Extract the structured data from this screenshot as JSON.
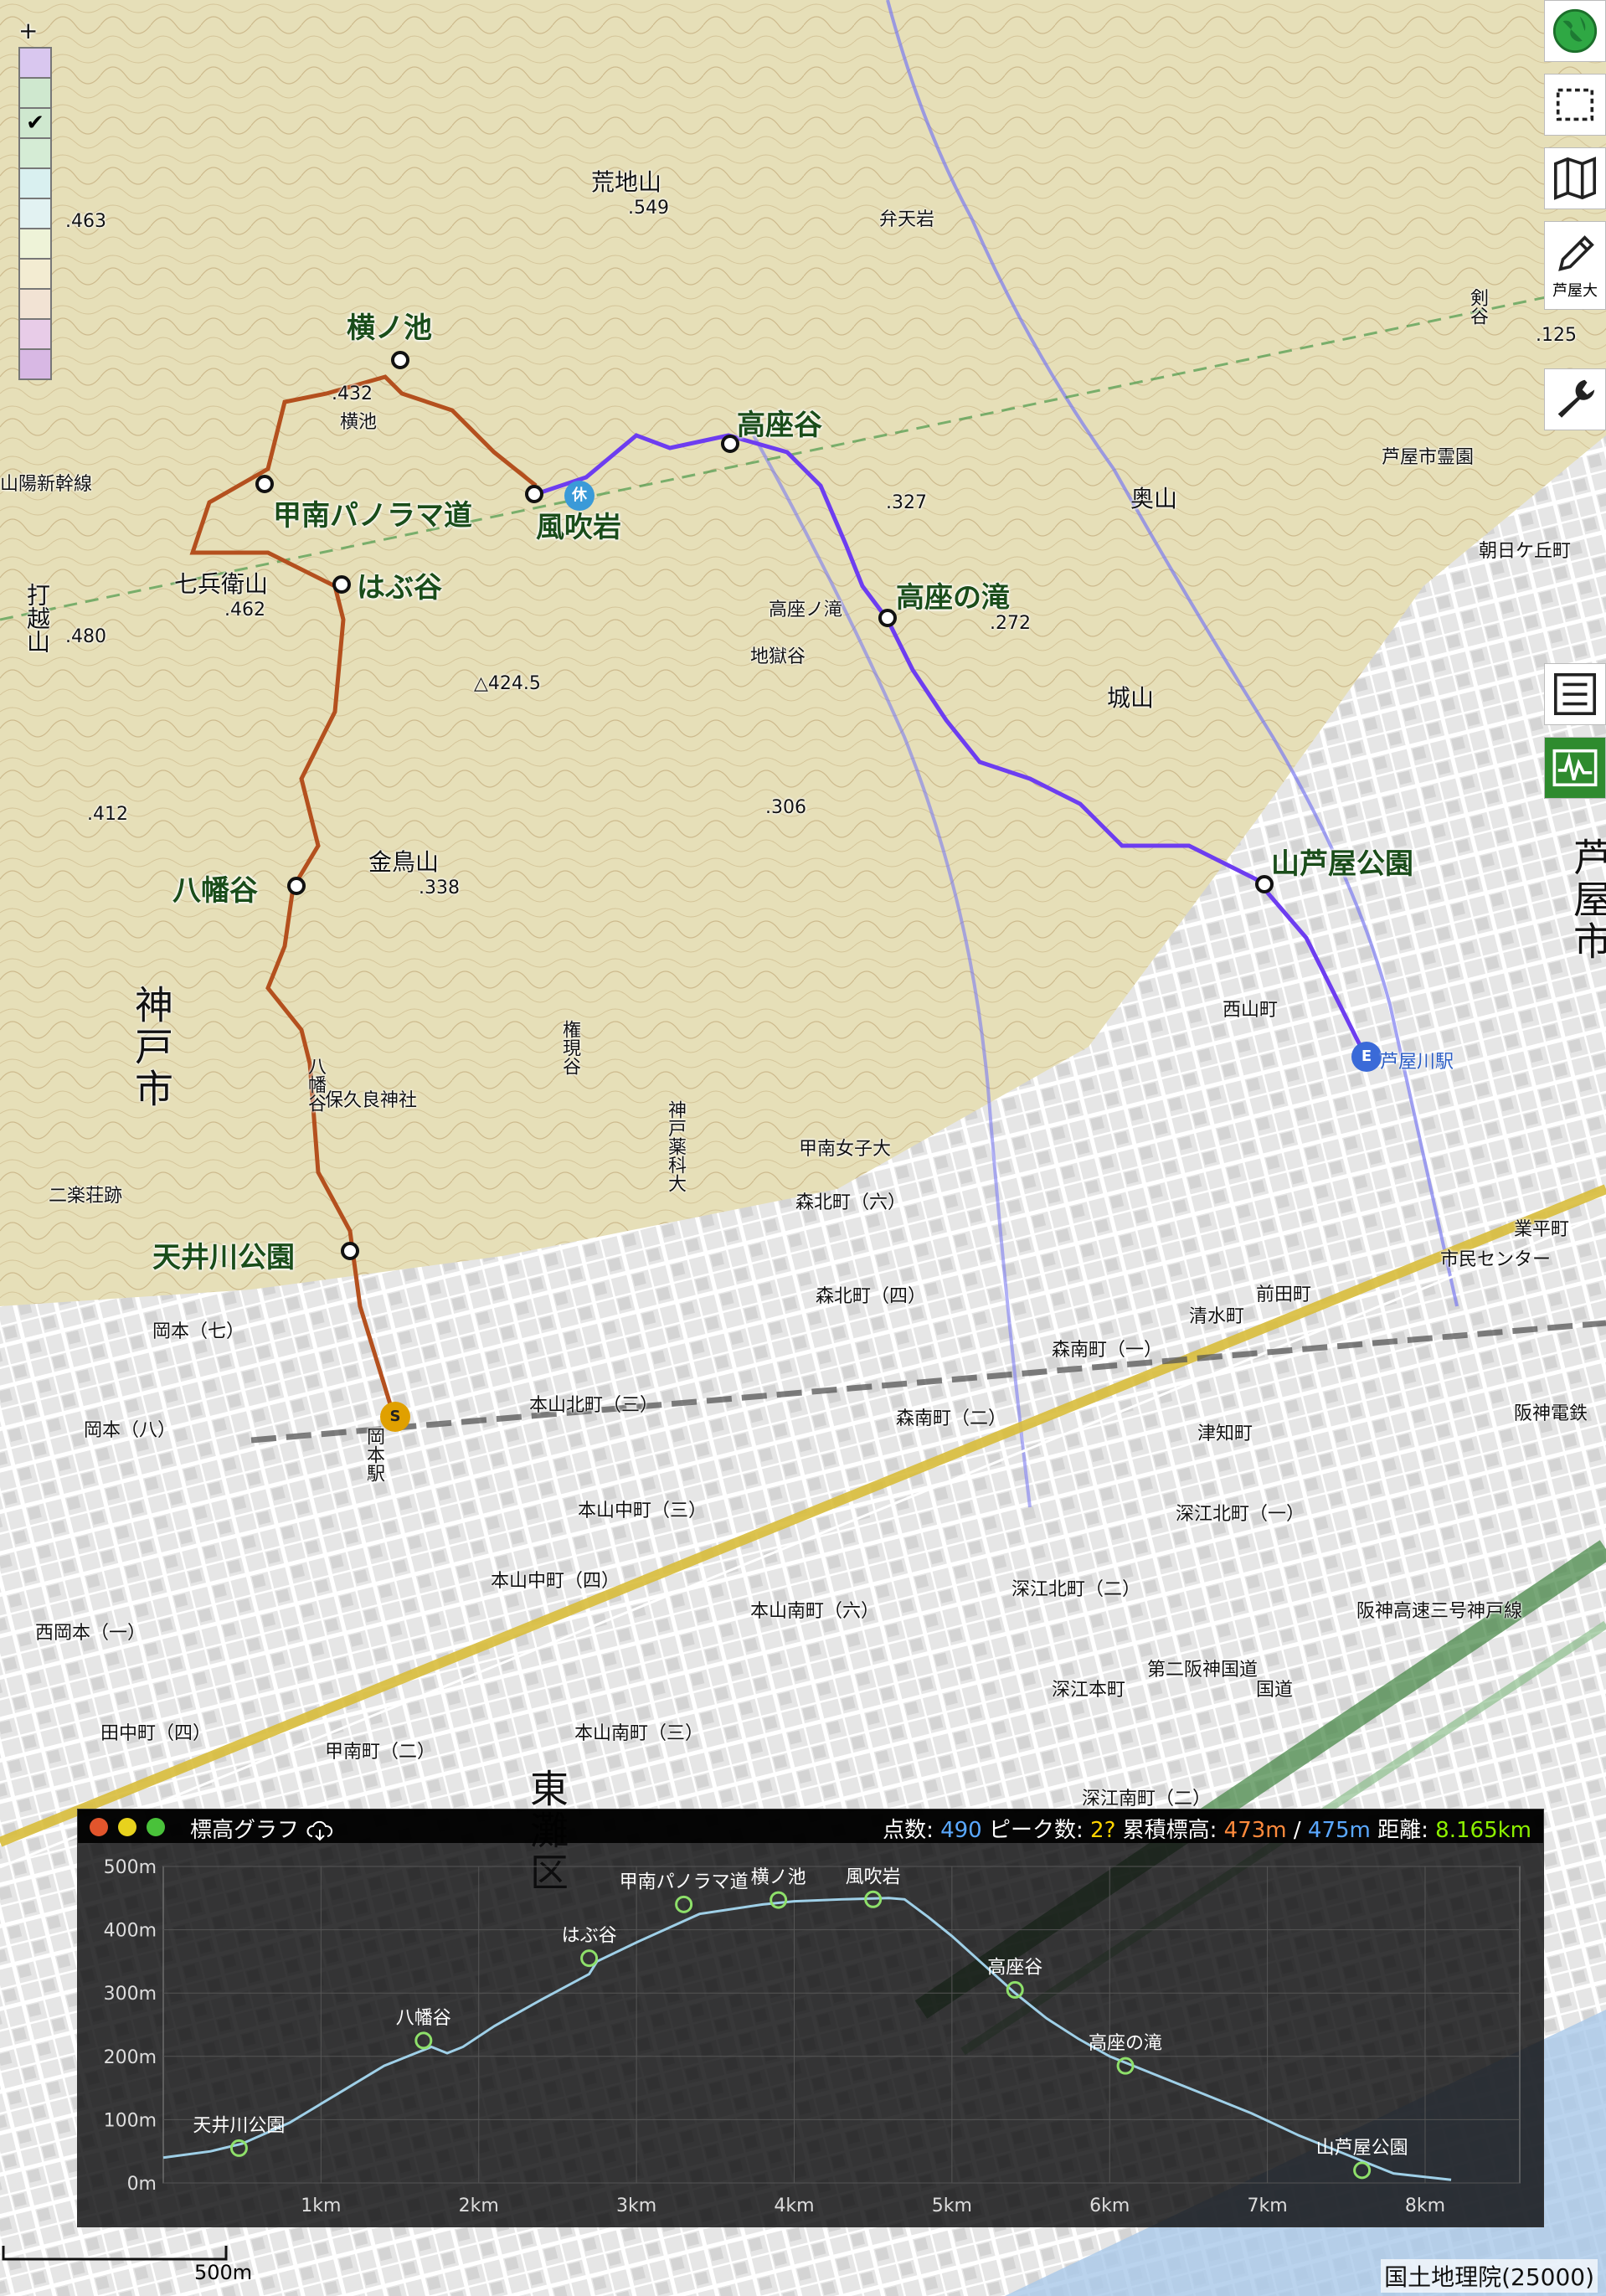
{
  "map": {
    "place_labels": [
      {
        "text": "荒地山",
        "style": "mid"
      },
      {
        "text": ".549",
        "style": "small"
      },
      {
        "text": "弁天岩",
        "style": "small"
      },
      {
        "text": ".463",
        "style": "small"
      },
      {
        "text": ".432",
        "style": "small"
      },
      {
        "text": "横池",
        "style": "small"
      },
      {
        "text": "七兵衛山",
        "style": "mid"
      },
      {
        "text": ".462",
        "style": "small"
      },
      {
        "text": "打越山",
        "style": "mid"
      },
      {
        "text": ".480",
        "style": "small"
      },
      {
        "text": "△424.5",
        "style": "small"
      },
      {
        "text": ".412",
        "style": "small"
      },
      {
        "text": ".306",
        "style": "small"
      },
      {
        "text": "金鳥山",
        "style": "mid"
      },
      {
        "text": ".338",
        "style": "small"
      },
      {
        "text": ".327",
        "style": "small"
      },
      {
        "text": "高座ノ滝",
        "style": "small"
      },
      {
        "text": "地獄谷",
        "style": "small"
      },
      {
        "text": ".272",
        "style": "small"
      },
      {
        "text": "奥山",
        "style": "mid"
      },
      {
        "text": "城山",
        "style": "mid"
      },
      {
        "text": "芦屋市霊園",
        "style": "small"
      },
      {
        "text": "朝日ケ丘町",
        "style": "small"
      },
      {
        "text": "剣谷",
        "style": "small"
      },
      {
        "text": ".125",
        "style": "small"
      },
      {
        "text": "神戸市",
        "style": "big"
      },
      {
        "text": "芦屋市",
        "style": "big"
      },
      {
        "text": "東灘区",
        "style": "big"
      },
      {
        "text": "保久良神社",
        "style": "small"
      },
      {
        "text": "権現谷",
        "style": "small"
      },
      {
        "text": "八幡谷",
        "style": "small"
      },
      {
        "text": "二楽荘跡",
        "style": "small"
      },
      {
        "text": "甲南女子大",
        "style": "small"
      },
      {
        "text": "神戸薬科大",
        "style": "small"
      },
      {
        "text": "森北町（六）",
        "style": "small"
      },
      {
        "text": "森北町（四）",
        "style": "small"
      },
      {
        "text": "本山北町（三）",
        "style": "small"
      },
      {
        "text": "岡本（七）",
        "style": "small"
      },
      {
        "text": "岡本（八）",
        "style": "small"
      },
      {
        "text": "岡本駅",
        "style": "small"
      },
      {
        "text": "本山中町（三）",
        "style": "small"
      },
      {
        "text": "本山中町（四）",
        "style": "small"
      },
      {
        "text": "本山南町（六）",
        "style": "small"
      },
      {
        "text": "本山南町（三）",
        "style": "small"
      },
      {
        "text": "田中町（四）",
        "style": "small"
      },
      {
        "text": "甲南町（二）",
        "style": "small"
      },
      {
        "text": "西岡本（一）",
        "style": "small"
      },
      {
        "text": "森南町（一）",
        "style": "small"
      },
      {
        "text": "森南町（二）",
        "style": "small"
      },
      {
        "text": "深江北町（一）",
        "style": "small"
      },
      {
        "text": "深江北町（二）",
        "style": "small"
      },
      {
        "text": "深江本町",
        "style": "small"
      },
      {
        "text": "深江南町（二）",
        "style": "small"
      },
      {
        "text": "前田町",
        "style": "small"
      },
      {
        "text": "清水町",
        "style": "small"
      },
      {
        "text": "津知町",
        "style": "small"
      },
      {
        "text": "西山町",
        "style": "small"
      },
      {
        "text": "市民センター",
        "style": "small"
      },
      {
        "text": "業平町",
        "style": "small"
      },
      {
        "text": "阪神電鉄",
        "style": "small"
      },
      {
        "text": "阪神高速三号神戸線",
        "style": "small"
      },
      {
        "text": "第二阪神国道",
        "style": "small"
      },
      {
        "text": "山陽新幹線",
        "style": "small"
      },
      {
        "text": "国道",
        "style": "small"
      }
    ],
    "waypoints": [
      {
        "name": "横ノ池"
      },
      {
        "name": "甲南パノラマ道"
      },
      {
        "name": "風吹岩"
      },
      {
        "name": "高座谷"
      },
      {
        "name": "はぶ谷"
      },
      {
        "name": "高座の滝"
      },
      {
        "name": "八幡谷"
      },
      {
        "name": "山芦屋公園"
      },
      {
        "name": "天井川公園"
      }
    ],
    "badges": {
      "start": "S",
      "end": "E",
      "rest": "休"
    },
    "station_label": "芦屋川駅",
    "scale_label": "500m",
    "attribution": "国土地理院(25000)",
    "route_colors": {
      "climb": "#b4501e",
      "descent": "#6d3df0"
    },
    "palette_colors": [
      "#d9c7ef",
      "#cfe8cf",
      "#cfe8cf",
      "#d5ecd5",
      "#d9f0f0",
      "#e2f2f2",
      "#eef3d8",
      "#f3ecd2",
      "#f2e3d4",
      "#e8cce8",
      "#d8b8e4"
    ]
  },
  "toolbar": {
    "tools": [
      {
        "icon": "globe-icon"
      },
      {
        "icon": "select-rect-icon"
      },
      {
        "icon": "map-icon"
      },
      {
        "icon": "pencil-icon"
      },
      {
        "icon": "wrench-icon"
      },
      {
        "icon": "list-icon"
      },
      {
        "icon": "elevation-graph-icon"
      }
    ],
    "city_label": "芦屋大"
  },
  "elevation_panel": {
    "title": "標高グラフ",
    "stats": {
      "points_label": "点数:",
      "points_value": "490",
      "peaks_label": "ピーク数:",
      "peaks_value": "2?",
      "gain_label": "累積標高:",
      "gain_up": "473m",
      "gain_sep": "/",
      "gain_down": "475m",
      "distance_label": "距離:",
      "distance_value": "8.165km"
    }
  },
  "chart_data": {
    "type": "line",
    "title": "",
    "xlabel": "",
    "ylabel": "",
    "xlim": [
      0,
      8.165
    ],
    "ylim": [
      0,
      500
    ],
    "x_ticks": [
      "1km",
      "2km",
      "3km",
      "4km",
      "5km",
      "6km",
      "7km",
      "8km"
    ],
    "y_ticks": [
      "0m",
      "100m",
      "200m",
      "300m",
      "400m",
      "500m"
    ],
    "series": [
      {
        "values": [
          [
            0,
            40
          ],
          [
            0.3,
            50
          ],
          [
            0.5,
            62
          ],
          [
            0.8,
            95
          ],
          [
            1.1,
            140
          ],
          [
            1.4,
            185
          ],
          [
            1.6,
            205
          ],
          [
            1.7,
            215
          ],
          [
            1.8,
            205
          ],
          [
            1.9,
            215
          ],
          [
            2.1,
            248
          ],
          [
            2.4,
            290
          ],
          [
            2.7,
            330
          ],
          [
            2.75,
            350
          ],
          [
            3.0,
            380
          ],
          [
            3.4,
            425
          ],
          [
            3.8,
            440
          ],
          [
            4.0,
            445
          ],
          [
            4.3,
            448
          ],
          [
            4.6,
            450
          ],
          [
            4.7,
            448
          ],
          [
            4.85,
            420
          ],
          [
            5.0,
            390
          ],
          [
            5.2,
            345
          ],
          [
            5.4,
            300
          ],
          [
            5.6,
            260
          ],
          [
            5.8,
            228
          ],
          [
            6.0,
            200
          ],
          [
            6.3,
            170
          ],
          [
            6.6,
            140
          ],
          [
            6.9,
            110
          ],
          [
            7.2,
            75
          ],
          [
            7.5,
            45
          ],
          [
            7.8,
            15
          ],
          [
            8.165,
            5
          ]
        ]
      }
    ],
    "annotations": [
      {
        "label": "天井川公園",
        "x": 0.48,
        "y": 55
      },
      {
        "label": "八幡谷",
        "x": 1.65,
        "y": 225
      },
      {
        "label": "はぶ谷",
        "x": 2.7,
        "y": 355
      },
      {
        "label": "甲南パノラマ道",
        "x": 3.3,
        "y": 440
      },
      {
        "label": "横ノ池",
        "x": 3.9,
        "y": 447
      },
      {
        "label": "風吹岩",
        "x": 4.5,
        "y": 448
      },
      {
        "label": "高座谷",
        "x": 5.4,
        "y": 305
      },
      {
        "label": "高座の滝",
        "x": 6.1,
        "y": 185
      },
      {
        "label": "山芦屋公園",
        "x": 7.6,
        "y": 20
      }
    ]
  }
}
